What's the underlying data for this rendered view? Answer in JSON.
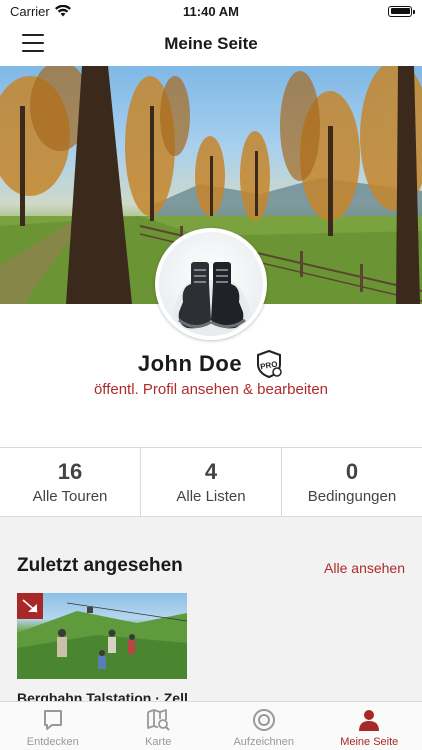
{
  "status_bar": {
    "carrier": "Carrier",
    "time": "11:40 AM"
  },
  "nav": {
    "title": "Meine Seite"
  },
  "profile": {
    "name": "John  Doe",
    "badge_text": "PRO",
    "link": "öffentl. Profil ansehen & bearbeiten"
  },
  "stats": [
    {
      "value": "16",
      "label": "Alle Touren"
    },
    {
      "value": "4",
      "label": "Alle Listen"
    },
    {
      "value": "0",
      "label": "Bedingungen"
    }
  ],
  "recent": {
    "title": "Zuletzt angesehen",
    "see_all": "Alle ansehen",
    "items": [
      {
        "title": "Bergbahn Talstation · Zell"
      }
    ]
  },
  "tabs": [
    {
      "label": "Entdecken",
      "icon": "chat-bubble-icon"
    },
    {
      "label": "Karte",
      "icon": "map-search-icon"
    },
    {
      "label": "Aufzeichnen",
      "icon": "record-icon"
    },
    {
      "label": "Meine Seite",
      "icon": "person-icon"
    }
  ],
  "colors": {
    "accent": "#b02a2a",
    "tab_active": "#a82828",
    "tab_inactive": "#999999"
  }
}
